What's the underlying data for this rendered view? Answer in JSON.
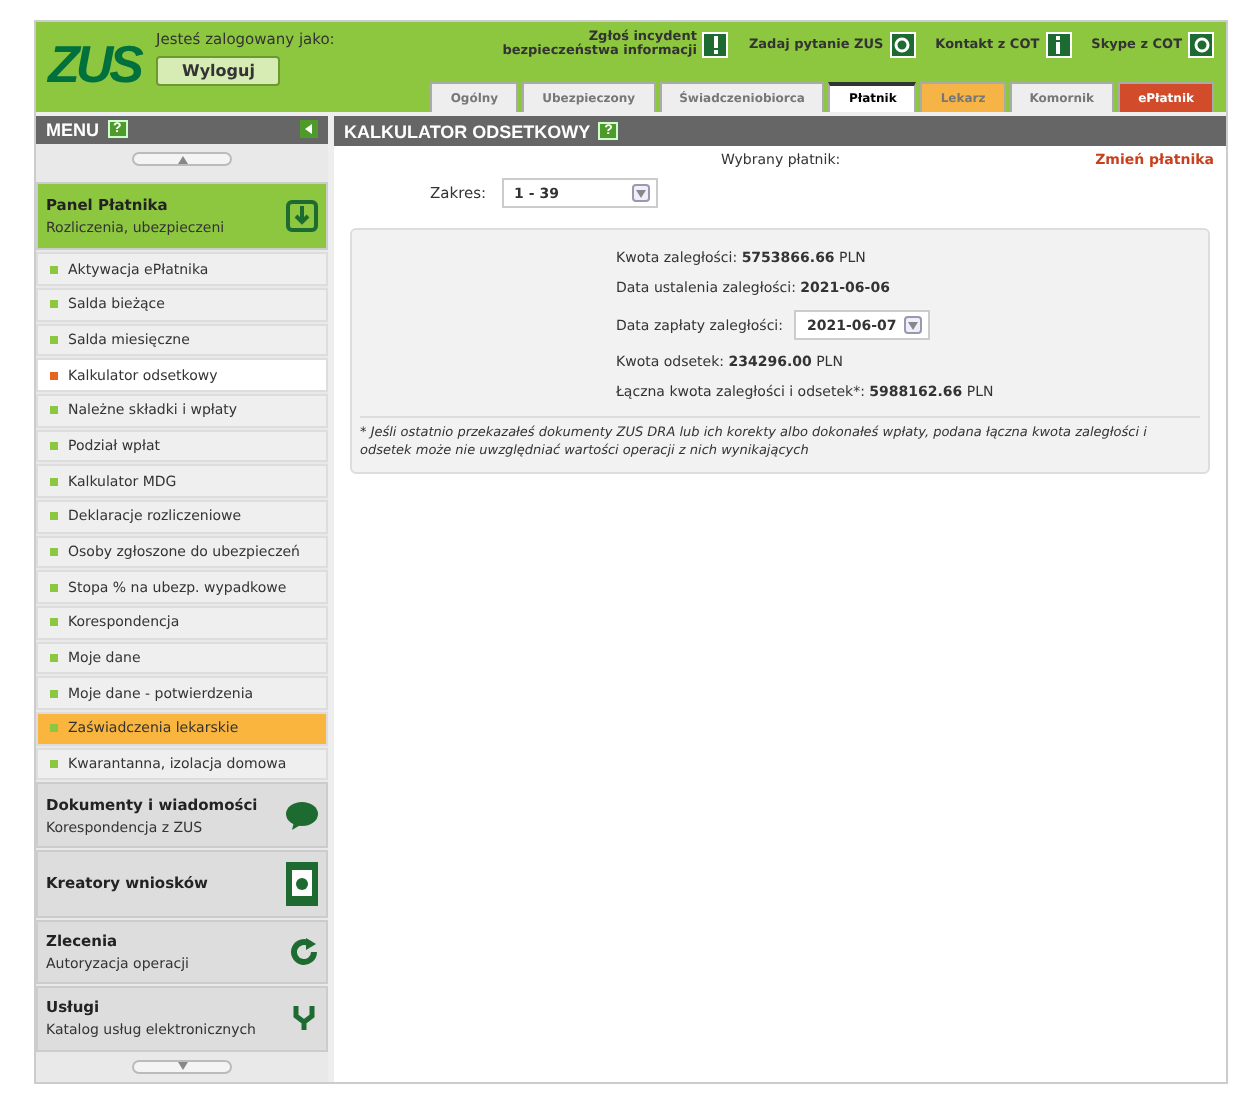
{
  "header": {
    "logo": "ZUS",
    "logged_in_label": "Jesteś zalogowany jako:",
    "logout_button": "Wyloguj",
    "links": [
      {
        "label": "Zgłoś incydent bezpieczeństwa informacji"
      },
      {
        "label": "Zadaj pytanie ZUS"
      },
      {
        "label": "Kontakt z COT"
      },
      {
        "label": "Skype z COT"
      }
    ],
    "tabs": [
      {
        "label": "Ogólny",
        "selected": false,
        "color": "#eeeeee"
      },
      {
        "label": "Ubezpieczony",
        "selected": false,
        "color": "#eeeeee"
      },
      {
        "label": "Świadczeniobiorca",
        "selected": false,
        "color": "#eeeeee"
      },
      {
        "label": "Płatnik",
        "selected": true,
        "color": "#ffffff"
      },
      {
        "label": "Lekarz",
        "selected": false,
        "color": "#f6b447"
      },
      {
        "label": "Komornik",
        "selected": false,
        "color": "#eeeeee"
      },
      {
        "label": "ePłatnik",
        "selected": false,
        "color": "#d24b2a"
      }
    ]
  },
  "menu": {
    "title": "MENU",
    "help": "?",
    "sections": [
      {
        "title": "Panel Płatnika",
        "subtitle": "Rozliczenia, ubezpieczeni",
        "expanded": true,
        "items": [
          {
            "label": "Aktywacja ePłatnika",
            "selected": false,
            "highlighted": false
          },
          {
            "label": "Salda bieżące",
            "selected": false,
            "highlighted": false
          },
          {
            "label": "Salda miesięczne",
            "selected": false,
            "highlighted": false
          },
          {
            "label": "Kalkulator odsetkowy",
            "selected": true,
            "highlighted": false
          },
          {
            "label": "Należne składki i wpłaty",
            "selected": false,
            "highlighted": false
          },
          {
            "label": "Podział wpłat",
            "selected": false,
            "highlighted": false
          },
          {
            "label": "Kalkulator MDG",
            "selected": false,
            "highlighted": false
          },
          {
            "label": "Deklaracje rozliczeniowe",
            "selected": false,
            "highlighted": false
          },
          {
            "label": "Osoby zgłoszone do ubezpieczeń",
            "selected": false,
            "highlighted": false
          },
          {
            "label": "Stopa % na ubezp. wypadkowe",
            "selected": false,
            "highlighted": false
          },
          {
            "label": "Korespondencja",
            "selected": false,
            "highlighted": false
          },
          {
            "label": "Moje dane",
            "selected": false,
            "highlighted": false
          },
          {
            "label": "Moje dane - potwierdzenia",
            "selected": false,
            "highlighted": false
          },
          {
            "label": "Zaświadczenia lekarskie",
            "selected": false,
            "highlighted": true
          },
          {
            "label": "Kwarantanna, izolacja domowa",
            "selected": false,
            "highlighted": false
          }
        ]
      },
      {
        "title": "Dokumenty i wiadomości",
        "subtitle": "Korespondencja z ZUS",
        "expanded": false
      },
      {
        "title": "Kreatory wniosków",
        "expanded": false
      },
      {
        "title": "Zlecenia",
        "subtitle": "Autoryzacja operacji",
        "expanded": false
      },
      {
        "title": "Usługi",
        "subtitle": "Katalog usług elektronicznych",
        "expanded": false
      }
    ]
  },
  "main": {
    "title": "KALKULATOR ODSETKOWY",
    "help": "?",
    "payer_label": "Wybrany płatnik:",
    "change_payer": "Zmień płatnika",
    "range_label": "Zakres:",
    "range_value": "1 - 39",
    "lines": [
      {
        "kind": "text",
        "text": "Kwota zaległości: **5753866.66** PLN"
      },
      {
        "kind": "text",
        "text": "Data ustalenia zaległości: **2021-06-06**"
      },
      {
        "kind": "date",
        "label": "Data zapłaty zaległości:",
        "value": "2021-06-07"
      },
      {
        "kind": "text",
        "text": "Kwota odsetek: **234296.00** PLN"
      },
      {
        "kind": "text",
        "text": "Łączna kwota zaległości i odsetek*: **5988162.66** PLN"
      }
    ],
    "footnote": "* Jeśli ostatnio przekazałeś dokumenty ZUS DRA lub ich korekty albo dokonałeś wpłaty, podana łączna kwota zaległości i odsetek może nie uwzględniać wartości operacji z nich wynikających"
  }
}
